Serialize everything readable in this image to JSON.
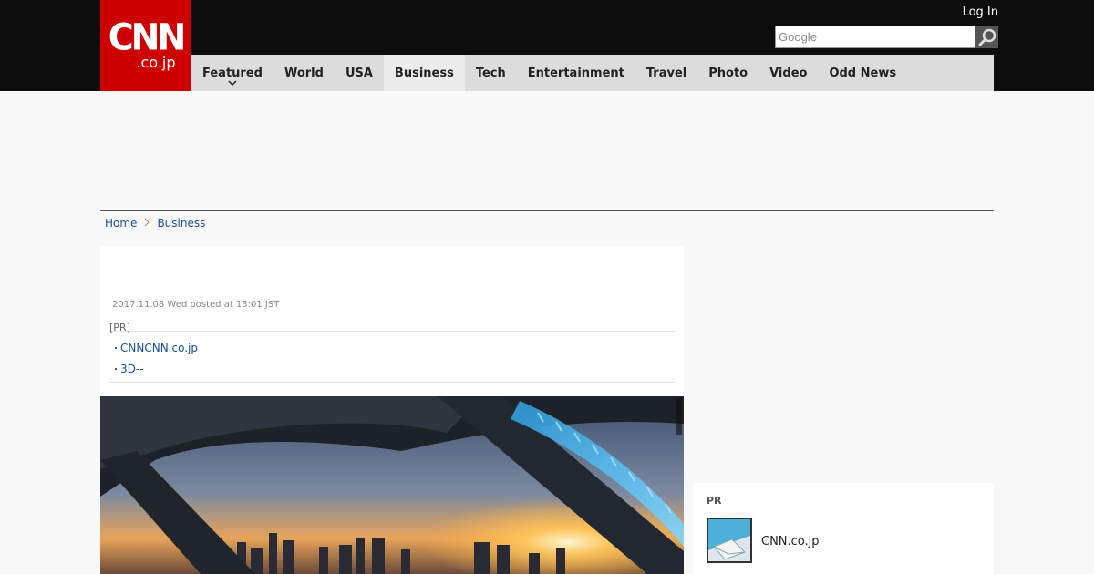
{
  "header": {
    "logo_text": "CNN",
    "logo_sub": ".co.jp",
    "login_label": "Log In",
    "search_placeholder": "Google",
    "search_icon": "magnifier-icon"
  },
  "nav": {
    "items": [
      {
        "label": "Featured",
        "has_dropdown": true
      },
      {
        "label": "World"
      },
      {
        "label": "USA"
      },
      {
        "label": "Business",
        "active": true
      },
      {
        "label": "Tech"
      },
      {
        "label": "Entertainment"
      },
      {
        "label": "Travel"
      },
      {
        "label": "Photo"
      },
      {
        "label": "Video"
      },
      {
        "label": "Odd News"
      }
    ],
    "dropdown_icon": "chevron-down-icon"
  },
  "breadcrumb": {
    "home": "Home",
    "current": "Business",
    "separator_icon": "chevron-right-icon"
  },
  "article": {
    "posted": "2017.11.08 Wed posted at 13:01 JST",
    "pr_label": "[PR]",
    "pr_links": [
      "CNNCNN.co.jp",
      "3D--"
    ],
    "bullet": "・"
  },
  "sidebar": {
    "pr_title": "PR",
    "pr_item": "CNN.co.jp"
  },
  "colors": {
    "brand_red": "#cc0000",
    "topbar": "#0c0c0c",
    "nav_bg": "#dcdcdc",
    "link": "#1a4f8a"
  }
}
